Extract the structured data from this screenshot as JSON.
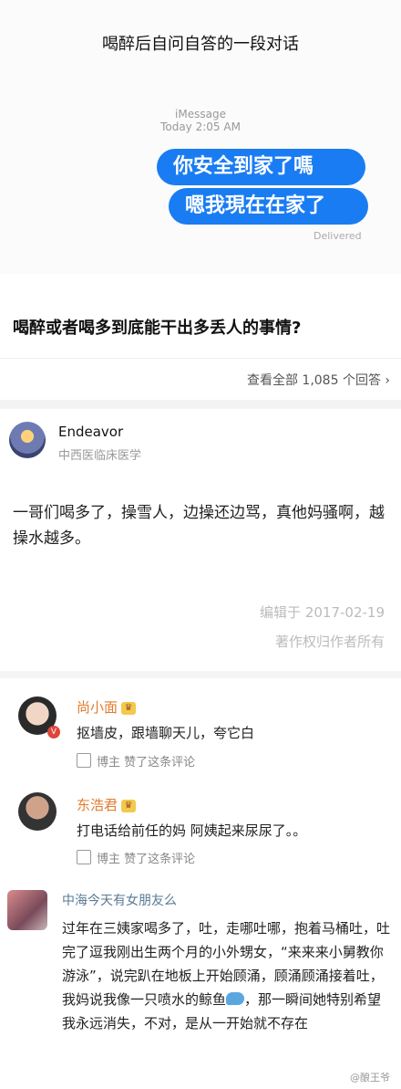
{
  "meme": {
    "title": "喝醉后自问自答的一段对话",
    "imessage_label": "iMessage",
    "imessage_time": "Today 2:05 AM",
    "bubble_1": "你安全到家了嗎",
    "bubble_2": "嗯我現在在家了",
    "delivered": "Delivered"
  },
  "question": {
    "title": "喝醉或者喝多到底能干出多丢人的事情?",
    "view_all": "查看全部 1,085 个回答 ›"
  },
  "answer": {
    "author": "Endeavor",
    "author_desc": "中西医临床医学",
    "body": "一哥们喝多了，操雪人，边操还边骂，真他妈骚啊，越操水越多。",
    "edit_date": "编辑于 2017-02-19",
    "copyright": "著作权归作者所有"
  },
  "comments": [
    {
      "name": "尚小面",
      "text": "抠墙皮，跟墙聊天儿，夸它白",
      "meta": "博主 赞了这条评论"
    },
    {
      "name": "东浩君",
      "text": "打电话给前任的妈 阿姨起来尿尿了。。",
      "meta": "博主 赞了这条评论"
    },
    {
      "name": "中海今天有女朋友么",
      "text_part1": "过年在三姨家喝多了，吐，走哪吐哪，抱着马桶吐，吐完了逗我刚出生两个月的小外甥女，“来来来小舅教你游泳”，说完趴在地板上开始顾涌，顾涌顾涌接着吐，我妈说我像一只喷水的鲸鱼",
      "text_part2": "，那一瞬间她特别希望我永远消失，不对，是从一开始就不存在"
    }
  ],
  "badges": {
    "vip": "V"
  },
  "watermark": "@酿王爷",
  "colors": {
    "bubble": "#1a7cf2",
    "comment_name": "#e07b2e",
    "muted": "#bbbbbb"
  }
}
